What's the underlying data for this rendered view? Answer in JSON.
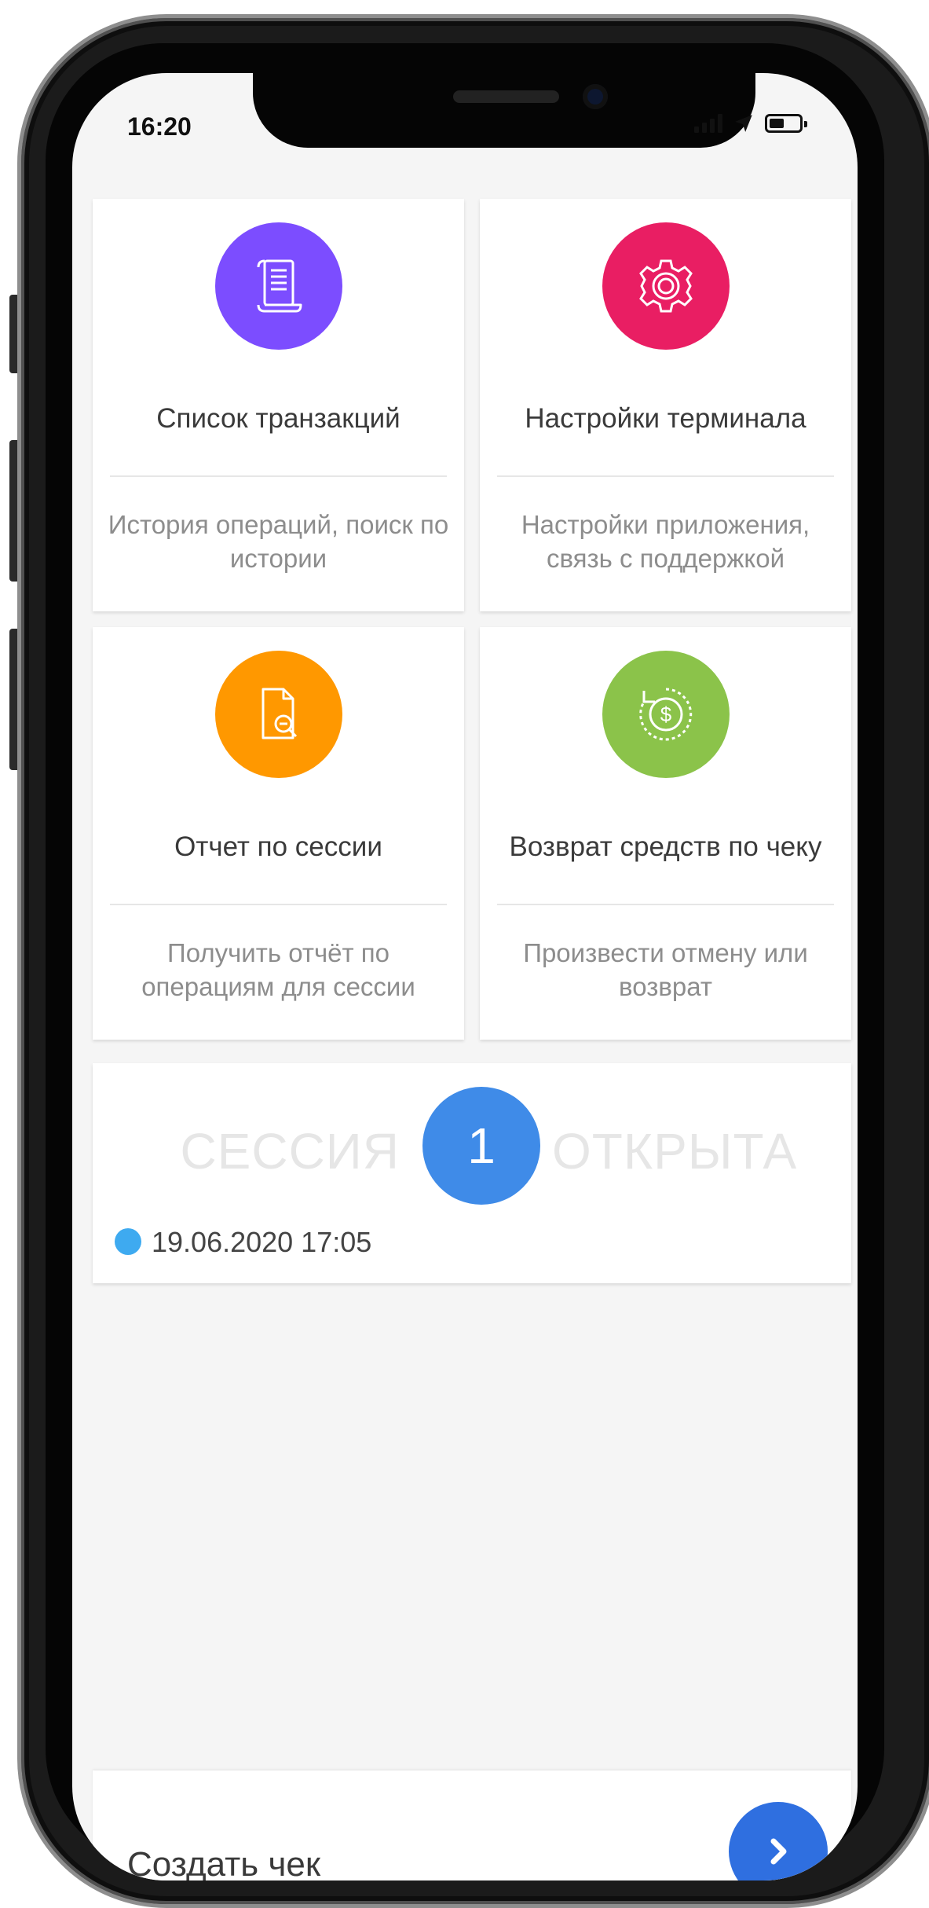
{
  "status_bar": {
    "time": "16:20"
  },
  "tiles": [
    {
      "title": "Список транзакций",
      "description": "История операций, поиск по истории",
      "icon": "scroll-icon",
      "color": "#7c4dff"
    },
    {
      "title": "Настройки терминала",
      "description": "Настройки приложения, связь с поддержкой",
      "icon": "gear-icon",
      "color": "#e91e63"
    },
    {
      "title": "Отчет по сессии",
      "description": "Получить отчёт по операциям для сессии",
      "icon": "report-icon",
      "color": "#ff9800"
    },
    {
      "title": "Возврат средств по чеку",
      "description": "Произвести отмену или возврат",
      "icon": "refund-dollar-icon",
      "color": "#8bc34a"
    }
  ],
  "session": {
    "word_before": "СЕССИЯ",
    "number": "1",
    "word_after": "ОТКРЫТА",
    "date": "19.06.2020 17:05",
    "badge_color": "#3f8be8",
    "dot_color": "#3eaaf0"
  },
  "bottom_bar": {
    "label": "Создать чек",
    "button_icon": "chevron-right-icon",
    "button_color": "#2f6fe0"
  }
}
